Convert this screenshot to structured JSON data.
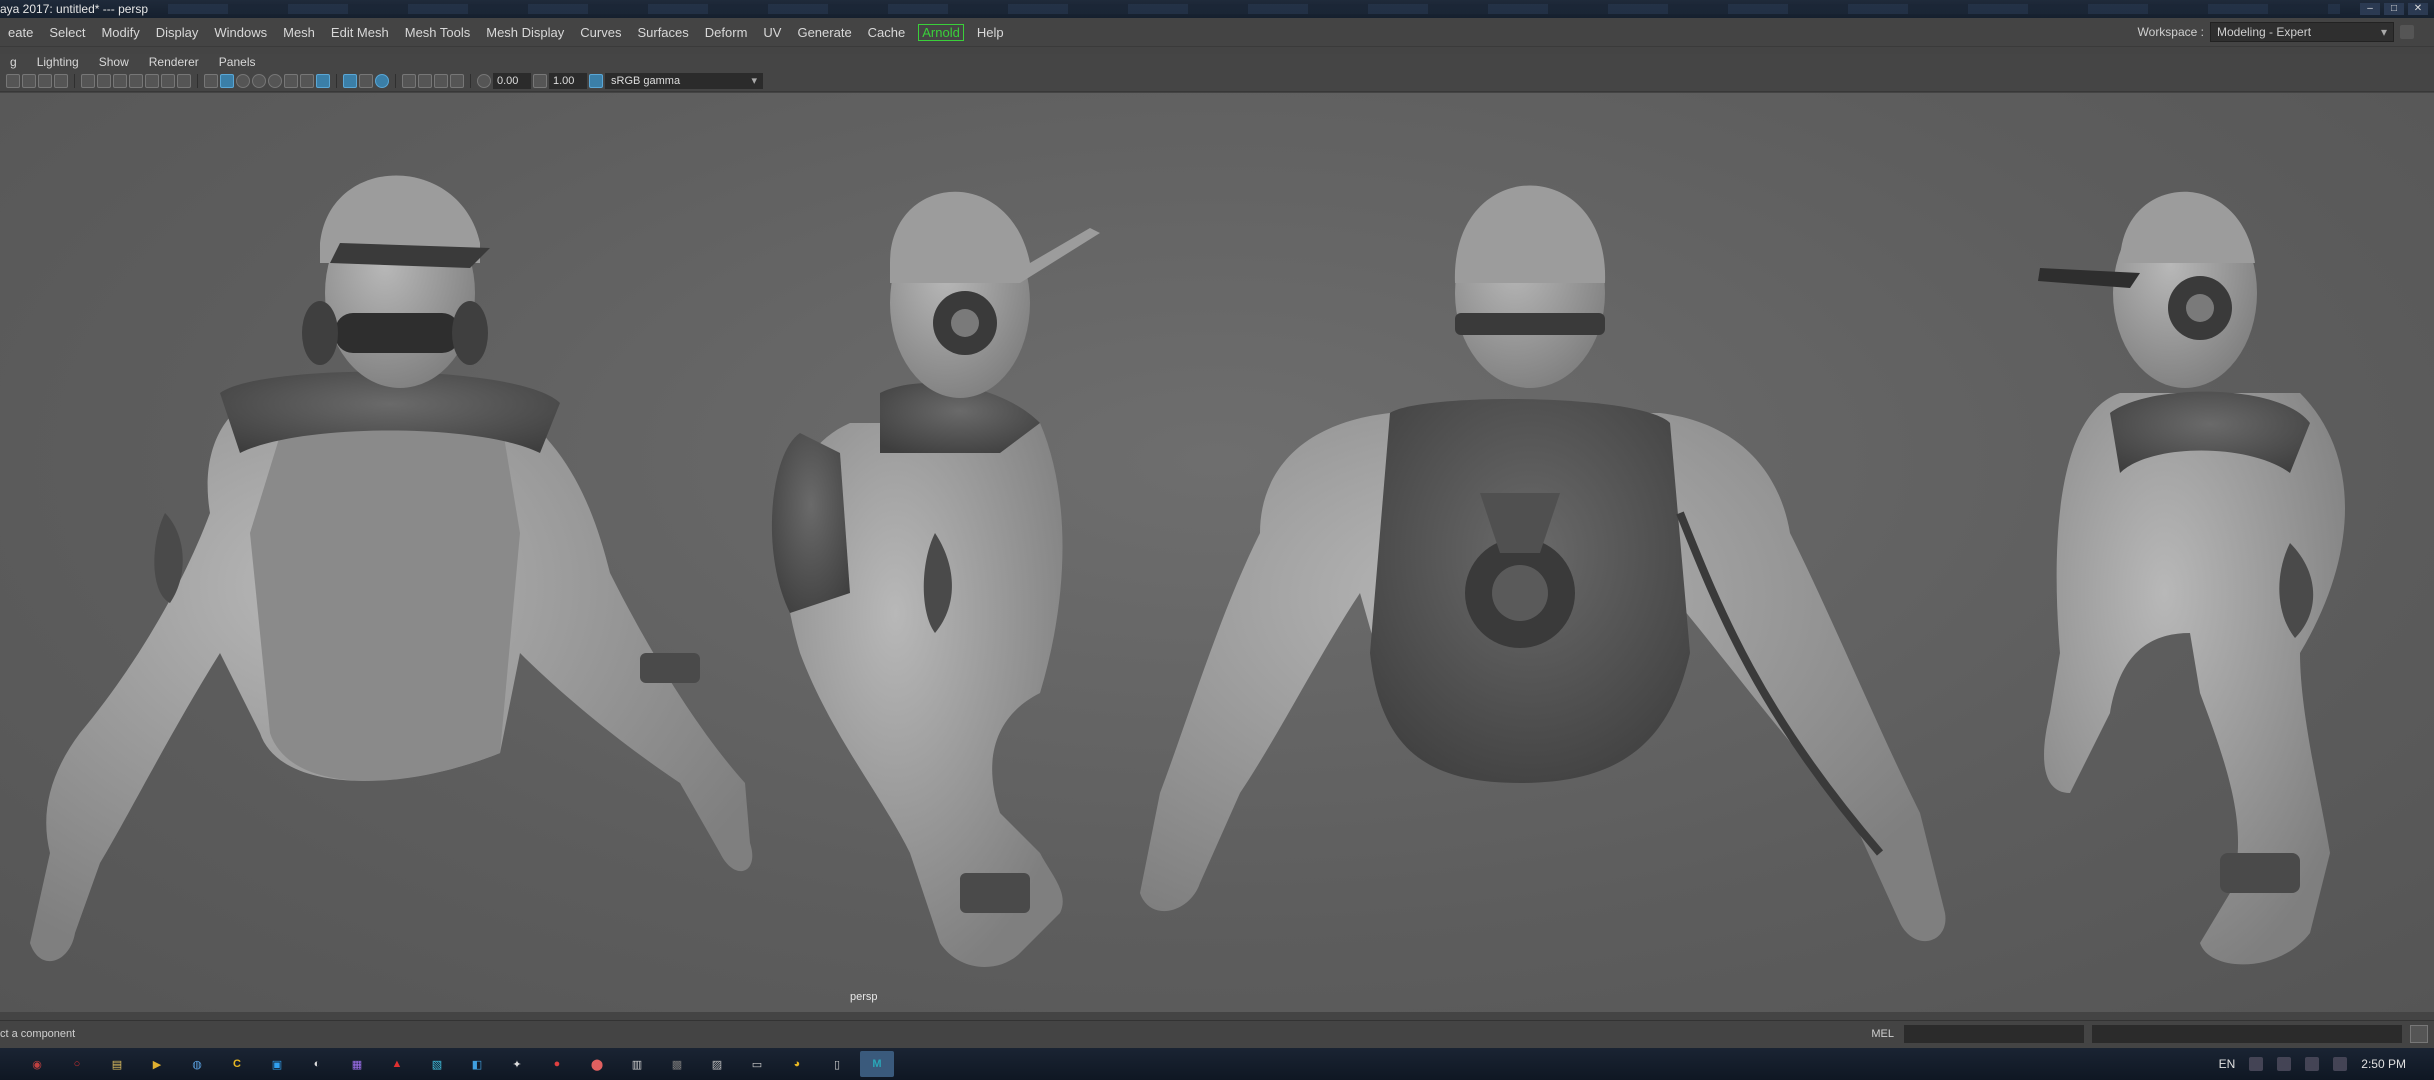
{
  "window": {
    "title": "aya 2017: untitled*   ---   persp"
  },
  "menubar": {
    "items": [
      "eate",
      "Select",
      "Modify",
      "Display",
      "Windows",
      "Mesh",
      "Edit Mesh",
      "Mesh Tools",
      "Mesh Display",
      "Curves",
      "Surfaces",
      "Deform",
      "UV",
      "Generate",
      "Cache",
      "Arnold",
      "Help"
    ],
    "workspace_label": "Workspace :",
    "workspace_value": "Modeling - Expert"
  },
  "panelmenu": {
    "items": [
      "g",
      "Lighting",
      "Show",
      "Renderer",
      "Panels"
    ]
  },
  "paneltoolbar": {
    "exposure": "0.00",
    "gamma": "1.00",
    "colorspace": "sRGB gamma"
  },
  "viewport": {
    "camera": "persp"
  },
  "helpline": {
    "message": "ct a component",
    "mel_label": "MEL"
  },
  "taskbar": {
    "apps": [
      {
        "name": "chrome-app",
        "label": "C",
        "color": "#e8b723"
      },
      {
        "name": "maya-app",
        "label": "M",
        "color": "#2aa6b8"
      }
    ],
    "language": "EN",
    "clock": "2:50 PM"
  },
  "colors": {
    "arnold": "#3ad03a",
    "viewport_bg": "#5d5d5d",
    "active_tool": "#3b7fa8"
  }
}
